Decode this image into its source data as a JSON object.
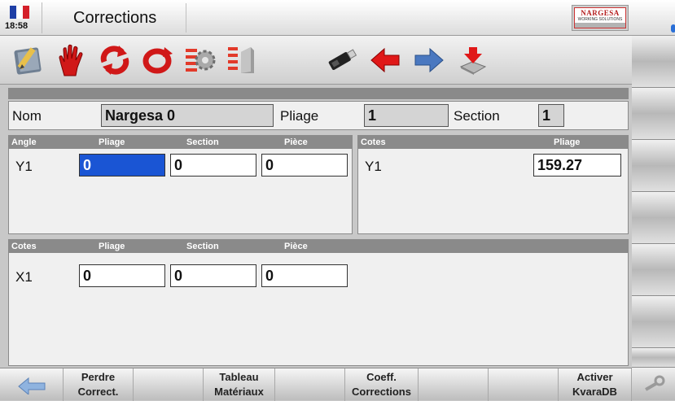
{
  "header": {
    "time": "18:58",
    "title": "Corrections",
    "logo_brand": "NARGESA",
    "logo_tagline": "WORKING SOLUTIONS",
    "flag_colors": [
      "#1f3fa6",
      "#ffffff",
      "#d4202a"
    ]
  },
  "toolbar": {
    "icons": [
      "edit-icon",
      "hand-stop-icon",
      "refresh-cycle-icon",
      "rotate-icon",
      "settings-list-icon",
      "checklist-icon",
      "usb-drive-icon",
      "arrow-left-icon",
      "arrow-right-icon",
      "download-icon"
    ]
  },
  "info_row": {
    "name_label": "Nom",
    "name_value": "Nargesa 0",
    "bend_label": "Pliage",
    "bend_value": "1",
    "section_label": "Section",
    "section_value": "1"
  },
  "angle_panel": {
    "headers": [
      "Angle",
      "Pliage",
      "Section",
      "Pièce"
    ],
    "row_label": "Y1",
    "values": [
      "0",
      "0",
      "0"
    ]
  },
  "cotes_y_panel": {
    "headers": [
      "Cotes",
      "Pliage"
    ],
    "row_label": "Y1",
    "value": "159.27"
  },
  "cotes_x_panel": {
    "headers": [
      "Cotes",
      "Pliage",
      "Section",
      "Pièce"
    ],
    "row_label": "X1",
    "values": [
      "0",
      "0",
      "0"
    ]
  },
  "bottom": {
    "back_icon": "arrow-left-icon",
    "buttons": [
      {
        "line1": "Perdre",
        "line2": "Correct."
      },
      {
        "line1": "Tableau",
        "line2": "Matériaux"
      },
      {
        "line1": "Coeff.",
        "line2": "Corrections"
      },
      {
        "line1": "Activer",
        "line2": "KvaraDB"
      }
    ],
    "tools_icon": "wrench-icon"
  },
  "colors": {
    "accent_red": "#d01818",
    "accent_blue": "#4a78c0",
    "selection_blue": "#1a55d4",
    "header_gray": "#8a8a8a"
  }
}
